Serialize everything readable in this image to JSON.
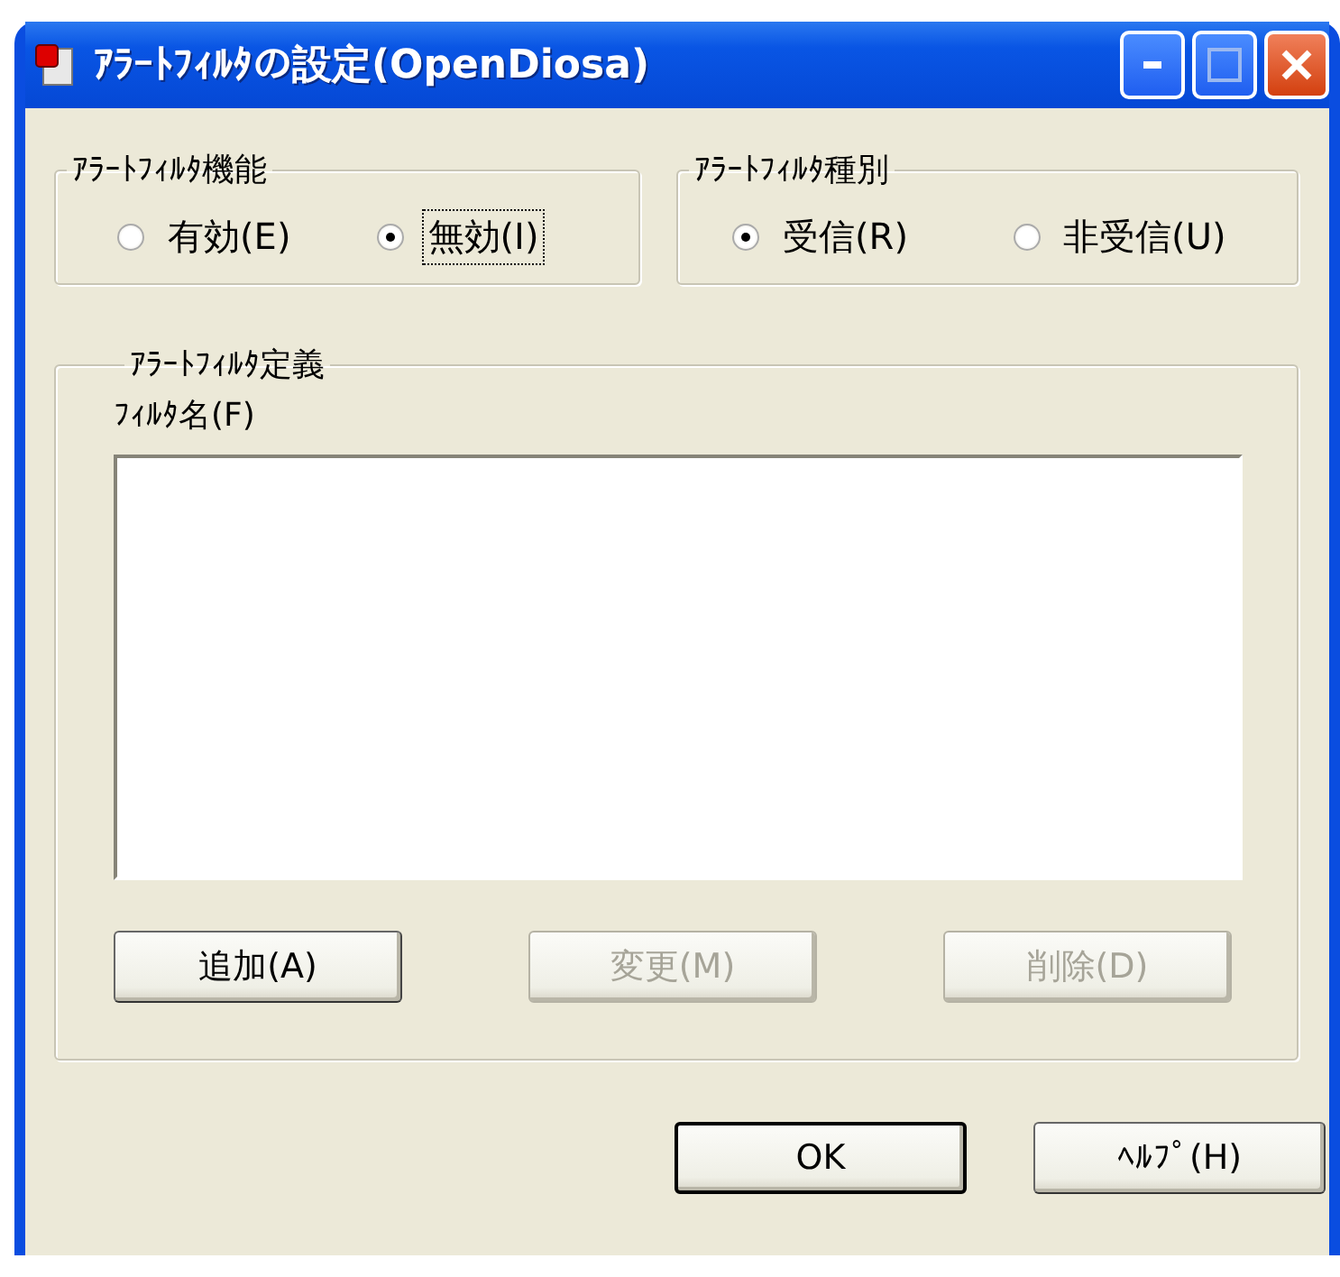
{
  "window": {
    "title": "ｱﾗｰﾄﾌｨﾙﾀの設定(OpenDiosa)"
  },
  "function_group": {
    "label": "ｱﾗｰﾄﾌｨﾙﾀ機能",
    "options": [
      {
        "label": "有効(E)",
        "selected": false,
        "focused": false
      },
      {
        "label": "無効(I)",
        "selected": true,
        "focused": true
      }
    ]
  },
  "type_group": {
    "label": "ｱﾗｰﾄﾌｨﾙﾀ種別",
    "options": [
      {
        "label": "受信(R)",
        "selected": true,
        "focused": false
      },
      {
        "label": "非受信(U)",
        "selected": false,
        "focused": false
      }
    ]
  },
  "definition_group": {
    "label": "ｱﾗｰﾄﾌｨﾙﾀ定義",
    "list_label": "ﾌｨﾙﾀ名(F)",
    "buttons": [
      {
        "label": "追加(A)",
        "disabled": false
      },
      {
        "label": "変更(M)",
        "disabled": true
      },
      {
        "label": "削除(D)",
        "disabled": true
      }
    ]
  },
  "buttons": [
    {
      "label": "OK",
      "default": true
    },
    {
      "label": "ﾍﾙﾌﾟ(H)",
      "default": false
    }
  ]
}
